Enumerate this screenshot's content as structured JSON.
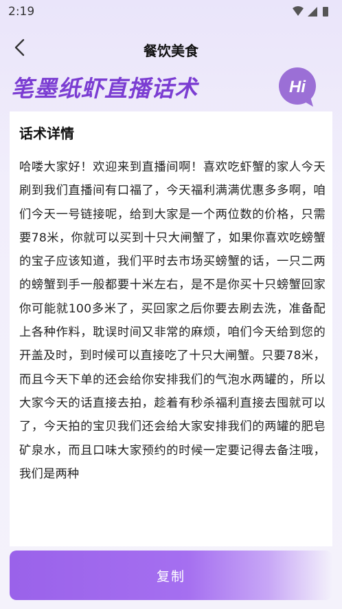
{
  "status_bar": {
    "time": "2:19",
    "icons": [
      "wifi-icon",
      "cellular-signal-icon",
      "battery-icon"
    ]
  },
  "nav": {
    "back_icon": "chevron-left-icon",
    "title": "餐饮美食"
  },
  "banner": {
    "title": "笔墨纸虾直播话术",
    "hi_badge": "Hi",
    "accent_color": "#7b3dd2",
    "badge_color": "#9b6fd6"
  },
  "card": {
    "title": "话术详情",
    "body": "哈喽大家好！欢迎来到直播间啊！喜欢吃虾蟹的家人今天刷到我们直播间有口福了，今天福利满满优惠多多啊，咱们今天一号链接呢，给到大家是一个两位数的价格，只需要78米，你就可以买到十只大闸蟹了，如果你喜欢吃螃蟹的宝子应该知道，我们平时去市场买螃蟹的话，一只二两的螃蟹到手一般都要十米左右，是不是你买十只螃蟹回家你可能就100多米了，买回家之后你要去刷去洗，准备配上各种作料，耽误时间又非常的麻烦，咱们今天给到您的开盖及时，到时候可以直接吃了十只大闸蟹。只要78米，而且今天下单的还会给你安排我们的气泡水两罐的，所以大家今天的话直接去拍，趁着有秒杀福利直接去囤就可以了，今天拍的宝贝我们还会给大家安排我们的两罐的肥皂矿泉水，而且口味大家预约的时候一定要记得去备注哦，我们是两种"
  },
  "footer": {
    "copy_label": "复制",
    "button_color": "#9a62ea"
  }
}
